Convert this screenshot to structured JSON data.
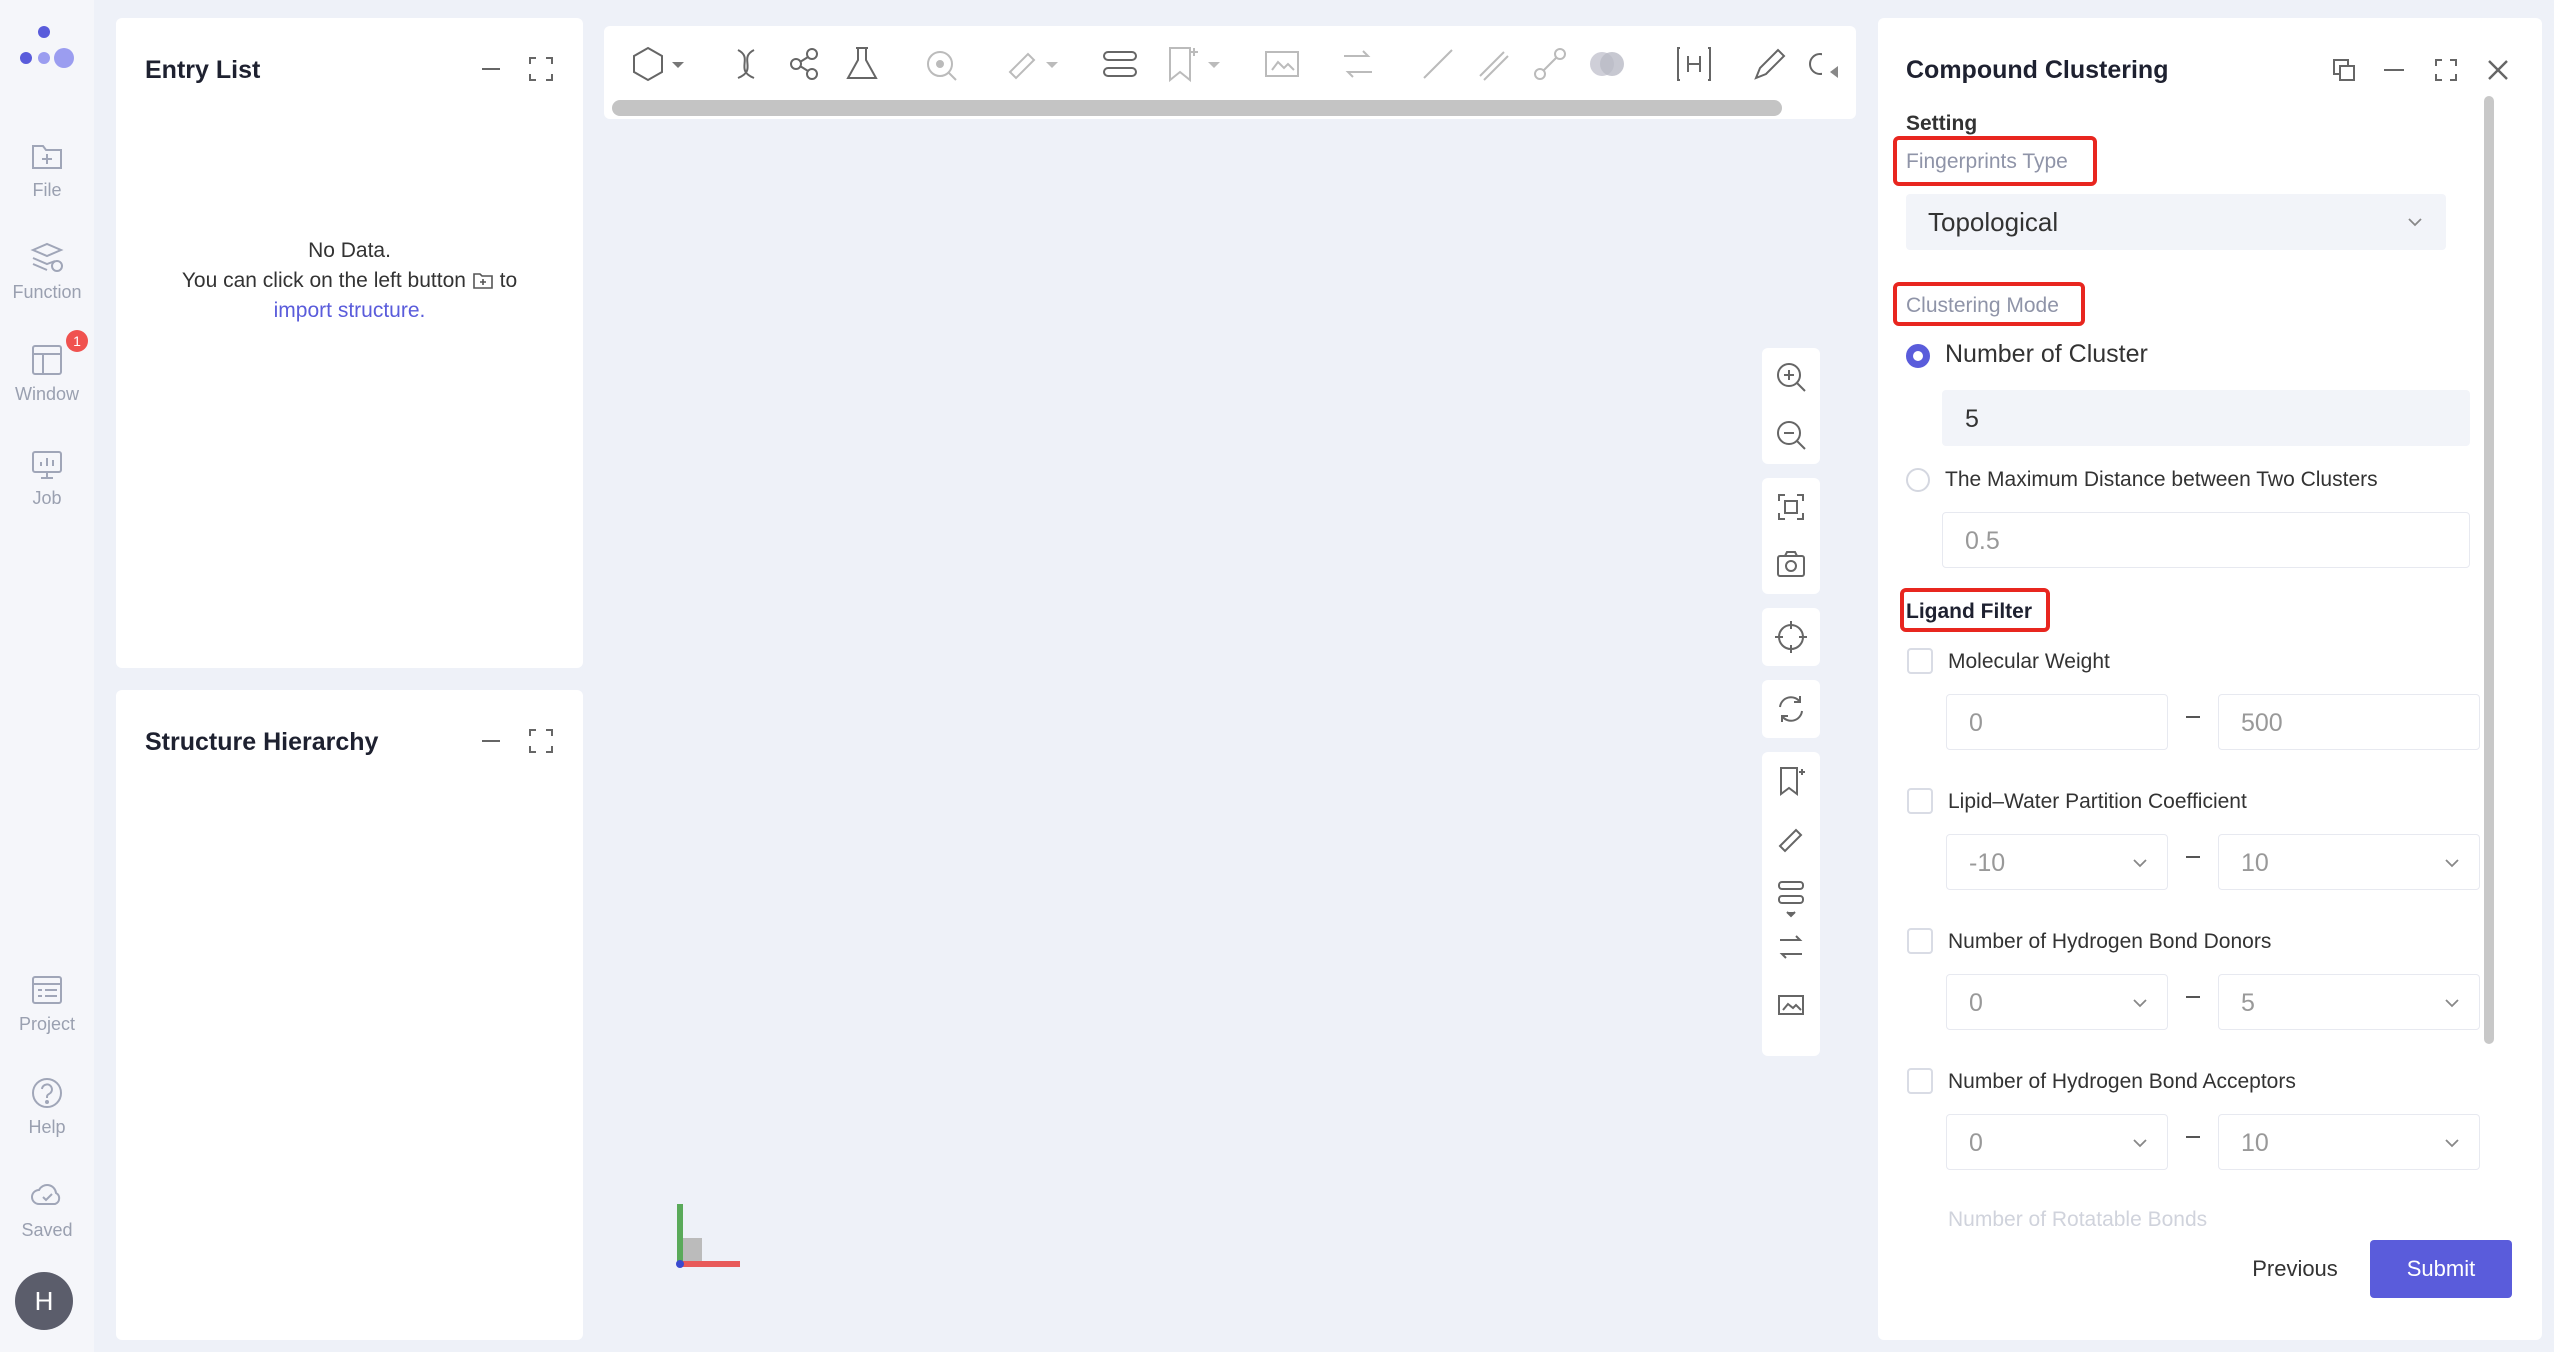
{
  "rail": {
    "items": [
      {
        "label": "File",
        "icon": "file-add-icon"
      },
      {
        "label": "Function",
        "icon": "function-icon"
      },
      {
        "label": "Window",
        "icon": "window-icon",
        "badge": "1"
      },
      {
        "label": "Job",
        "icon": "job-icon"
      },
      {
        "label": "Project",
        "icon": "project-icon"
      },
      {
        "label": "Help",
        "icon": "help-icon"
      },
      {
        "label": "Saved",
        "icon": "cloud-icon"
      }
    ],
    "avatar": "H"
  },
  "entry_list": {
    "title": "Entry List",
    "empty_line1": "No Data.",
    "empty_line2a": "You can click on the left button",
    "empty_line2b": "to",
    "empty_link": "import structure."
  },
  "structure_hierarchy": {
    "title": "Structure Hierarchy"
  },
  "clustering": {
    "title": "Compound Clustering",
    "section": "Setting",
    "fingerprints_label": "Fingerprints Type",
    "fingerprints_value": "Topological",
    "mode_label": "Clustering Mode",
    "option_count": "Number of Cluster",
    "option_count_value": "5",
    "option_distance": "The Maximum Distance between Two Clusters",
    "option_distance_value": "0.5",
    "ligand_filter_label": "Ligand Filter",
    "filters": [
      {
        "label": "Molecular Weight",
        "min": "0",
        "max": "500"
      },
      {
        "label": "Lipid–Water Partition Coefficient",
        "min": "-10",
        "max": "10"
      },
      {
        "label": "Number of Hydrogen Bond Donors",
        "min": "0",
        "max": "5"
      },
      {
        "label": "Number of Hydrogen Bond Acceptors",
        "min": "0",
        "max": "10"
      }
    ],
    "faded_next": "Number of Rotatable Bonds",
    "previous_label": "Previous",
    "submit_label": "Submit"
  },
  "colors": {
    "accent": "#5a5cdb",
    "highlight": "#e8261f",
    "badge": "#f0524f"
  }
}
